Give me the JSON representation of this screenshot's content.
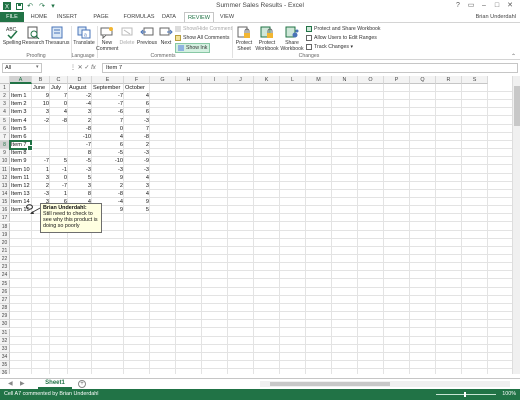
{
  "window": {
    "title": "Summer Sales Results - Excel",
    "user": "Brian Underdahl",
    "qat_icons": [
      "excel-logo-icon",
      "save-icon",
      "undo-icon",
      "redo-icon",
      "customize-icon"
    ],
    "winbtns": [
      "?",
      "▭",
      "–",
      "□",
      "✕"
    ]
  },
  "tabs": [
    "FILE",
    "HOME",
    "INSERT",
    "PAGE LAYOUT",
    "FORMULAS",
    "DATA",
    "REVIEW",
    "VIEW"
  ],
  "ribbon": {
    "proofing": {
      "spelling": "Spelling",
      "research": "Research",
      "thesaurus": "Thesaurus",
      "group": "Proofing"
    },
    "language": {
      "translate": "Translate",
      "group": "Language"
    },
    "comments": {
      "new": "New Comment",
      "delete": "Delete",
      "previous": "Previous",
      "next": "Next",
      "show_hide": "Show/Hide Comment",
      "show_all": "Show All Comments",
      "show_ink": "Show Ink",
      "group": "Comments"
    },
    "changes": {
      "protect_sheet": "Protect Sheet",
      "protect_workbook": "Protect Workbook",
      "share_workbook": "Share Workbook",
      "protect_share": "Protect and Share Workbook",
      "allow_edit": "Allow Users to Edit Ranges",
      "track": "Track Changes",
      "group": "Changes"
    }
  },
  "formula_bar": {
    "name_box": "All",
    "fx": "fx",
    "value": "Item 7"
  },
  "columns": [
    "A",
    "B",
    "C",
    "D",
    "E",
    "F",
    "G",
    "H",
    "I",
    "J",
    "K",
    "L",
    "M",
    "N",
    "O",
    "P",
    "Q",
    "R",
    "S"
  ],
  "selected": {
    "col": "A",
    "row": 8
  },
  "headers_row": [
    "",
    "June",
    "July",
    "August",
    "September",
    "October"
  ],
  "rows": [
    [
      "Item 1",
      "9",
      "7",
      "-2",
      "-7",
      "4"
    ],
    [
      "Item 2",
      "10",
      "0",
      "-4",
      "-7",
      "6"
    ],
    [
      "Item 3",
      "3",
      "4",
      "3",
      "-6",
      "6"
    ],
    [
      "Item 4",
      "-2",
      "-8",
      "2",
      "7",
      "-3"
    ],
    [
      "Item 5",
      "",
      "",
      "-8",
      "0",
      "7"
    ],
    [
      "Item 6",
      "",
      "",
      "-10",
      "4",
      "-8"
    ],
    [
      "Item 7",
      "",
      "",
      "-7",
      "6",
      "2"
    ],
    [
      "Item 8",
      "",
      "",
      "8",
      "-5",
      "-3"
    ],
    [
      "Item 9",
      "-7",
      "5",
      "-5",
      "-10",
      "-9"
    ],
    [
      "Item 10",
      "1",
      "-1",
      "-3",
      "-3",
      "-3"
    ],
    [
      "Item 11",
      "3",
      "0",
      "5",
      "9",
      "4"
    ],
    [
      "Item 12",
      "2",
      "-7",
      "3",
      "2",
      "3"
    ],
    [
      "Item 13",
      "-3",
      "1",
      "8",
      "-8",
      "4"
    ],
    [
      "Item 14",
      "3",
      "6",
      "4",
      "-4",
      "9"
    ],
    [
      "Item 15",
      "1",
      "6",
      "-5",
      "9",
      "5"
    ]
  ],
  "total_rows": 36,
  "comment": {
    "author": "Brian Underdahl:",
    "text": "Still need to check to see why this product is doing so poorly"
  },
  "sheet_tab": "Sheet1",
  "status": {
    "left": "Cell A7 commented by Brian Underdahl",
    "zoom": "100%"
  },
  "accent": "#217346"
}
